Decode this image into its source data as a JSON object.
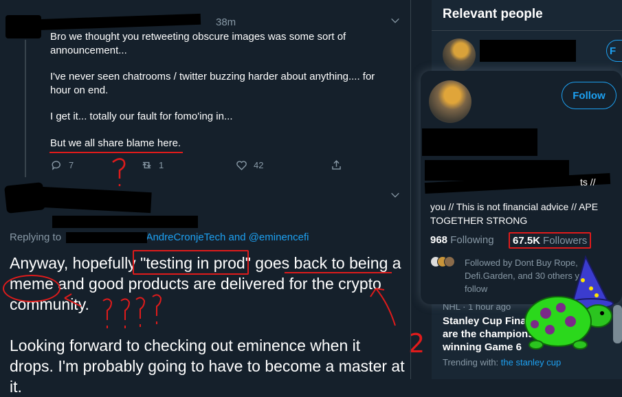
{
  "reply1": {
    "time": "38m",
    "paragraphs": [
      "Bro we thought you retweeting obscure images was some sort of announcement...",
      "I've never seen chatrooms / twitter buzzing harder about anything.... for hour on end.",
      "I get it... totally our fault for fomo'ing in...",
      "But we all share blame here."
    ],
    "actions": {
      "replies": "7",
      "retweets": "1",
      "likes": "42"
    }
  },
  "reply2": {
    "replying_prefix": "Replying to",
    "replying_handles": "@AndreCronjeTech and @eminencefi",
    "text_part1": "Anyway, hopefully ",
    "text_quote": "\"testing in prod\"",
    "text_part2": " goes back to being a meme and good products are delivered for the crypto community.",
    "text_para2": "Looking forward to checking out eminence when it drops. I'm probably going to have to become a master at it."
  },
  "sidebar": {
    "relevant_people_title": "Relevant people",
    "follow_short": "F",
    "trend": {
      "meta": "NHL · 1 hour ago",
      "title": "Stanley Cup Final: Lightning are the champions after winning Game 6",
      "trending_with_label": "Trending with:",
      "trending_with_link": "the stanley cup"
    }
  },
  "hovercard": {
    "follow_label": "Follow",
    "bio_fragment": "ts //",
    "bio_visible": "you // This is not financial advice // APE TOGETHER STRONG",
    "following_count": "968",
    "following_label": "Following",
    "followers_count": "67.5K",
    "followers_label": "Followers",
    "followed_by": "Followed by Dont Buy Rope, Defi.Garden, and 30 others you follow"
  },
  "annotations": {
    "number_2": "2"
  },
  "colors": {
    "background": "#15202b",
    "accent": "#1da1f2",
    "muted": "#8899a6",
    "annotation": "#e01b1b"
  }
}
